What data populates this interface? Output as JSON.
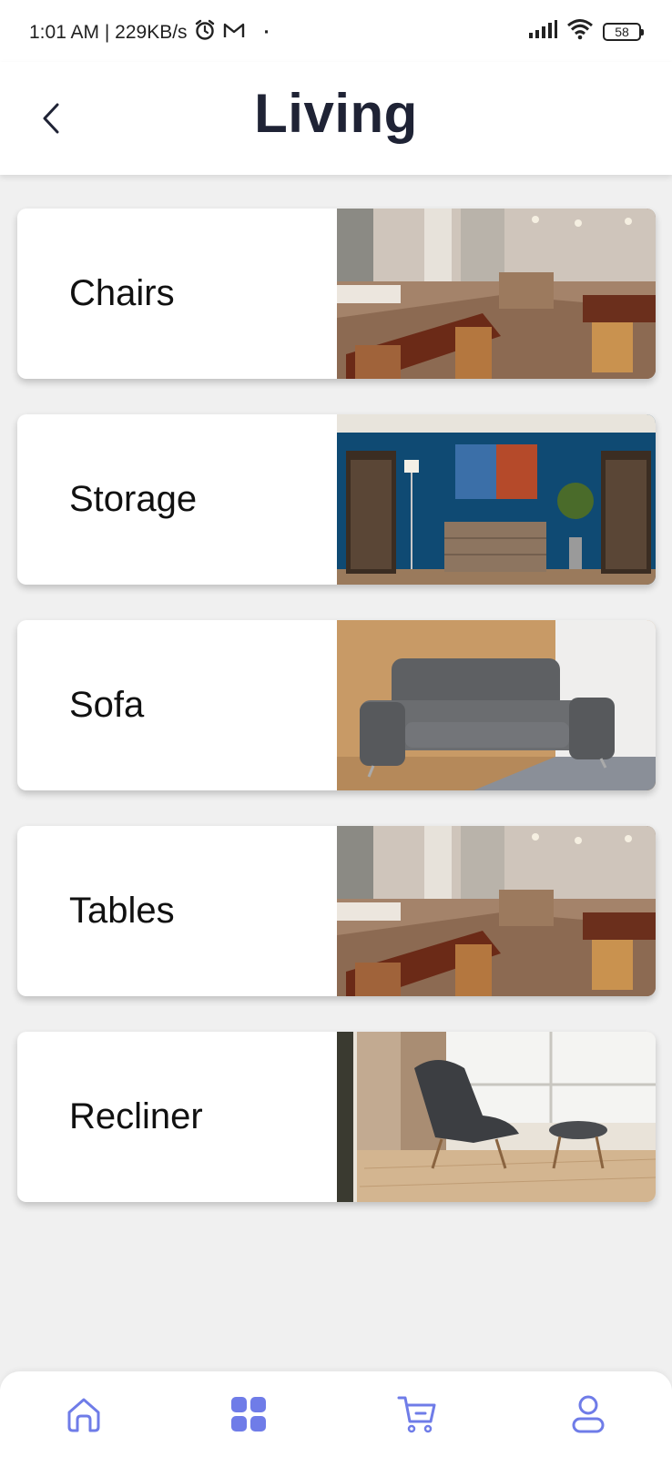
{
  "status_bar": {
    "time_speed": "1:01 AM | 229KB/s",
    "dot": "·",
    "battery": "58"
  },
  "header": {
    "title": "Living"
  },
  "categories": [
    {
      "label": "Chairs",
      "photo": "restaurant dining room"
    },
    {
      "label": "Storage",
      "photo": "blue room with sideboard and bookshelves"
    },
    {
      "label": "Sofa",
      "photo": "grey leather sofa"
    },
    {
      "label": "Tables",
      "photo": "restaurant dining room"
    },
    {
      "label": "Recliner",
      "photo": "lounge chair with footstool"
    }
  ],
  "bottom_nav": {
    "items": [
      "home-icon",
      "categories-icon",
      "cart-icon",
      "profile-icon"
    ],
    "accent_color": "#6f7ce8"
  }
}
